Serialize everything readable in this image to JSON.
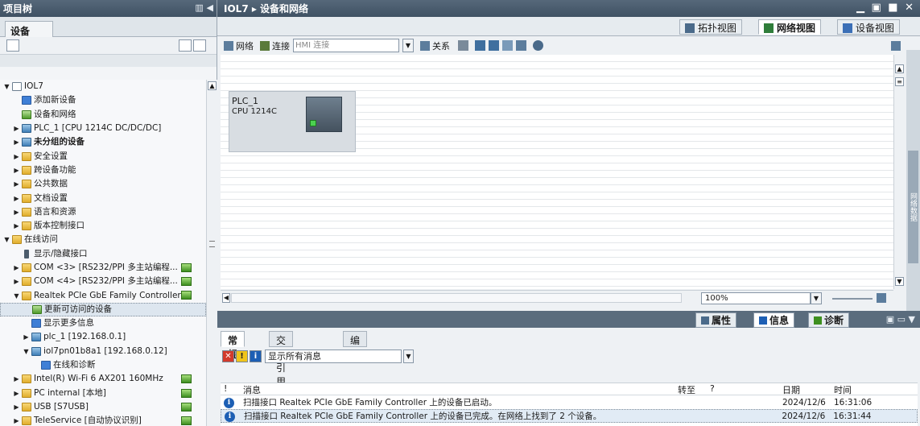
{
  "left_pane": {
    "title": "项目树",
    "devices_tab": "设备",
    "tree": [
      {
        "label": "IOL7",
        "level": 0,
        "toggle": "▼",
        "icon": "doc"
      },
      {
        "label": "添加新设备",
        "level": 1,
        "toggle": "",
        "icon": "add"
      },
      {
        "label": "设备和网络",
        "level": 1,
        "toggle": "",
        "icon": "net"
      },
      {
        "label": "PLC_1 [CPU 1214C DC/DC/DC]",
        "level": 1,
        "toggle": "▶",
        "icon": "plc"
      },
      {
        "label": "未分组的设备",
        "level": 1,
        "toggle": "▶",
        "icon": "plc",
        "bold": true
      },
      {
        "label": "安全设置",
        "level": 1,
        "toggle": "▶",
        "icon": "folder"
      },
      {
        "label": "跨设备功能",
        "level": 1,
        "toggle": "▶",
        "icon": "folder"
      },
      {
        "label": "公共数据",
        "level": 1,
        "toggle": "▶",
        "icon": "folder"
      },
      {
        "label": "文档设置",
        "level": 1,
        "toggle": "▶",
        "icon": "folder"
      },
      {
        "label": "语言和资源",
        "level": 1,
        "toggle": "▶",
        "icon": "folder"
      },
      {
        "label": "版本控制接口",
        "level": 1,
        "toggle": "▶",
        "icon": "folder"
      },
      {
        "label": "在线访问",
        "level": 0,
        "toggle": "▼",
        "icon": "folder"
      },
      {
        "label": "显示/隐藏接口",
        "level": 1,
        "toggle": "",
        "icon": "plug"
      },
      {
        "label": "COM <3> [RS232/PPI 多主站编程...",
        "level": 1,
        "toggle": "▶",
        "icon": "folder",
        "badge": true
      },
      {
        "label": "COM <4> [RS232/PPI 多主站编程...",
        "level": 1,
        "toggle": "▶",
        "icon": "folder",
        "badge": true
      },
      {
        "label": "Realtek PCIe GbE Family Controller",
        "level": 1,
        "toggle": "▼",
        "icon": "folder",
        "badge": true
      },
      {
        "label": "更新可访问的设备",
        "level": 2,
        "toggle": "",
        "icon": "net",
        "selected": true
      },
      {
        "label": "显示更多信息",
        "level": 2,
        "toggle": "",
        "icon": "blue"
      },
      {
        "label": "plc_1 [192.168.0.1]",
        "level": 2,
        "toggle": "▶",
        "icon": "plc"
      },
      {
        "label": "iol7pn01b8a1 [192.168.0.12]",
        "level": 2,
        "toggle": "▼",
        "icon": "plc"
      },
      {
        "label": "在线和诊断",
        "level": 3,
        "toggle": "",
        "icon": "blue"
      },
      {
        "label": "Intel(R) Wi-Fi 6 AX201 160MHz",
        "level": 1,
        "toggle": "▶",
        "icon": "folder",
        "badge": true
      },
      {
        "label": "PC internal [本地]",
        "level": 1,
        "toggle": "▶",
        "icon": "folder",
        "badge": true
      },
      {
        "label": "USB [S7USB]",
        "level": 1,
        "toggle": "▶",
        "icon": "folder",
        "badge": true
      },
      {
        "label": "TeleService [自动协议识别]",
        "level": 1,
        "toggle": "▶",
        "icon": "folder",
        "badge": true
      }
    ]
  },
  "editor": {
    "title": "IOL7 ▸ 设备和网络",
    "view_tabs": {
      "topology": "拓扑视图",
      "network": "网络视图",
      "device": "设备视图"
    },
    "toolbar": {
      "network": "网络",
      "connect": "连接",
      "connect_type": "HMI 连接",
      "relations": "关系"
    },
    "plc": {
      "name": "PLC_1",
      "type": "CPU 1214C"
    },
    "zoom": "100%",
    "side_label": "网络数据"
  },
  "inspector": {
    "tabs": {
      "properties": "属性",
      "info": "信息",
      "diagnostics": "诊断"
    },
    "subtabs": {
      "general": "常规",
      "cross_ref": "交叉引用",
      "compile": "编译"
    },
    "filter": "显示所有消息",
    "columns": {
      "flag": "!",
      "message": "消息",
      "goto": "转至",
      "q": "?",
      "date": "日期",
      "time": "时间"
    },
    "messages": [
      {
        "text": "扫描接口 Realtek PCIe GbE Family Controller 上的设备已启动。",
        "date": "2024/12/6",
        "time": "16:31:06"
      },
      {
        "text": "扫描接口 Realtek PCIe GbE Family Controller 上的设备已完成。在网络上找到了 2 个设备。",
        "date": "2024/12/6",
        "time": "16:31:44"
      }
    ]
  },
  "colors": {
    "title_bar": "#4a5c6e",
    "accent": "#1d5fb4",
    "status_green": "#3d8f1f"
  }
}
